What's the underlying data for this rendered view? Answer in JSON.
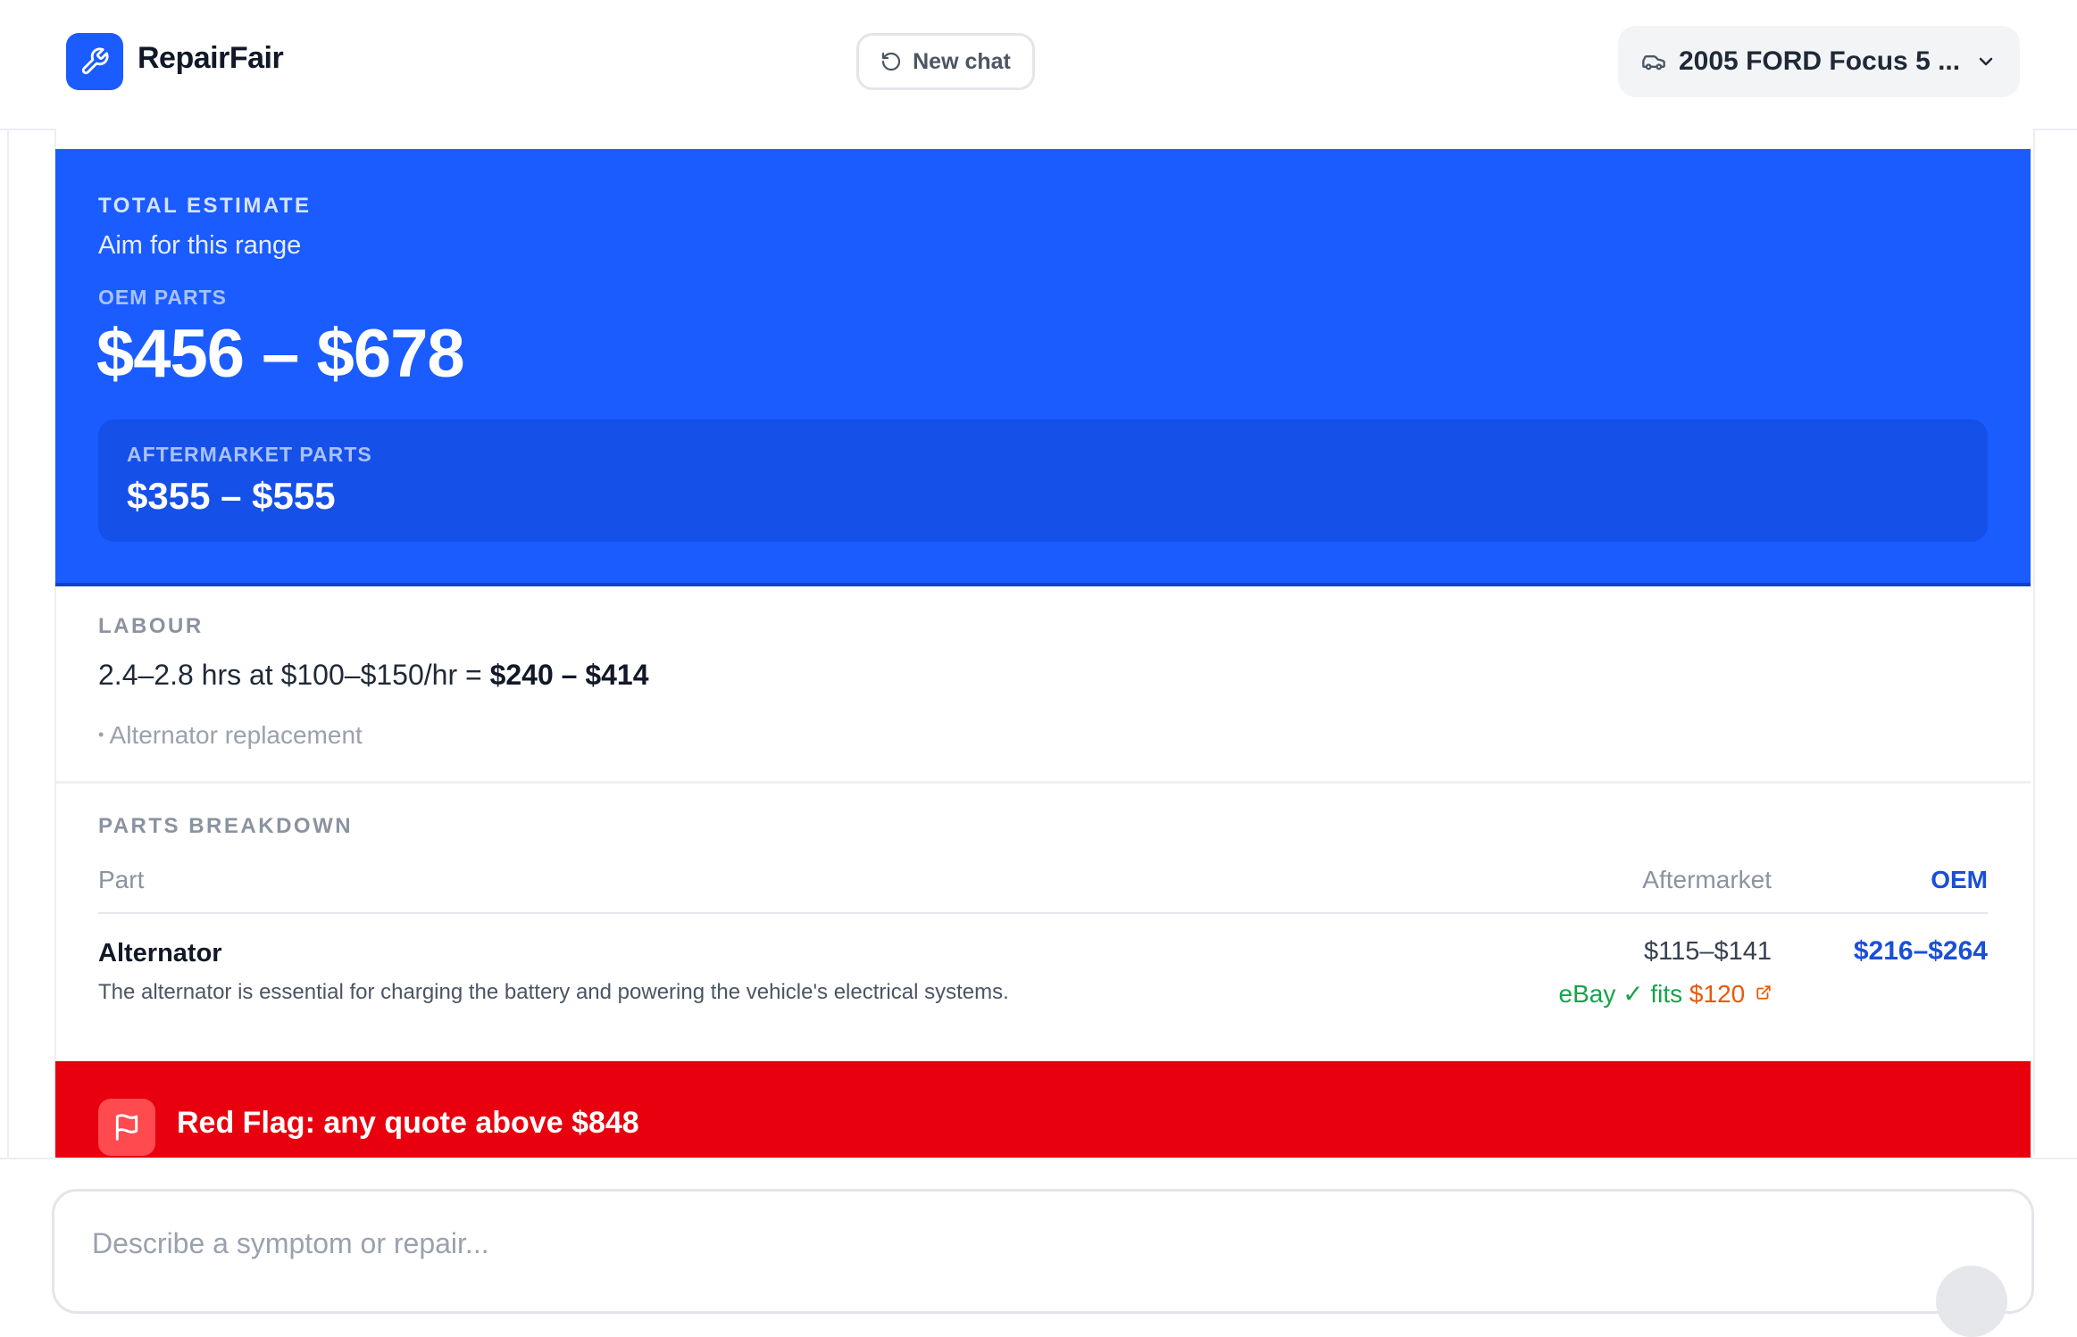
{
  "header": {
    "app_name": "RepairFair",
    "new_chat_label": "New chat",
    "vehicle_label": "2005 FORD Focus 5 ..."
  },
  "estimate": {
    "eyebrow": "TOTAL ESTIMATE",
    "subtitle": "Aim for this range",
    "oem_label": "OEM PARTS",
    "oem_range": "$456 – $678",
    "aftermarket_label": "AFTERMARKET PARTS",
    "aftermarket_range": "$355 – $555"
  },
  "labour": {
    "title": "LABOUR",
    "formula": "2.4–2.8 hrs at $100–$150/hr = ",
    "total": "$240 – $414",
    "items": [
      "Alternator replacement"
    ]
  },
  "parts": {
    "title": "PARTS BREAKDOWN",
    "columns": {
      "part": "Part",
      "aftermarket": "Aftermarket",
      "oem": "OEM"
    },
    "rows": [
      {
        "name": "Alternator",
        "description": "The alternator is essential for charging the battery and powering the vehicle's electrical systems.",
        "aftermarket_price": "$115–$141",
        "ebay_label": "eBay ✓ fits ",
        "ebay_price": "$120",
        "oem_price": "$216–$264"
      }
    ]
  },
  "red_flag": {
    "text": "Red Flag: any quote above $848"
  },
  "composer": {
    "placeholder": "Describe a symptom or repair..."
  },
  "colors": {
    "brand_blue": "#1a5cff",
    "red_flag": "#e8000e",
    "ebay_green": "#16a34a",
    "ebay_orange": "#ea580c"
  },
  "icons": [
    "wrench-icon",
    "refresh-icon",
    "car-icon",
    "chevron-down-icon",
    "flag-icon",
    "external-link-icon"
  ]
}
